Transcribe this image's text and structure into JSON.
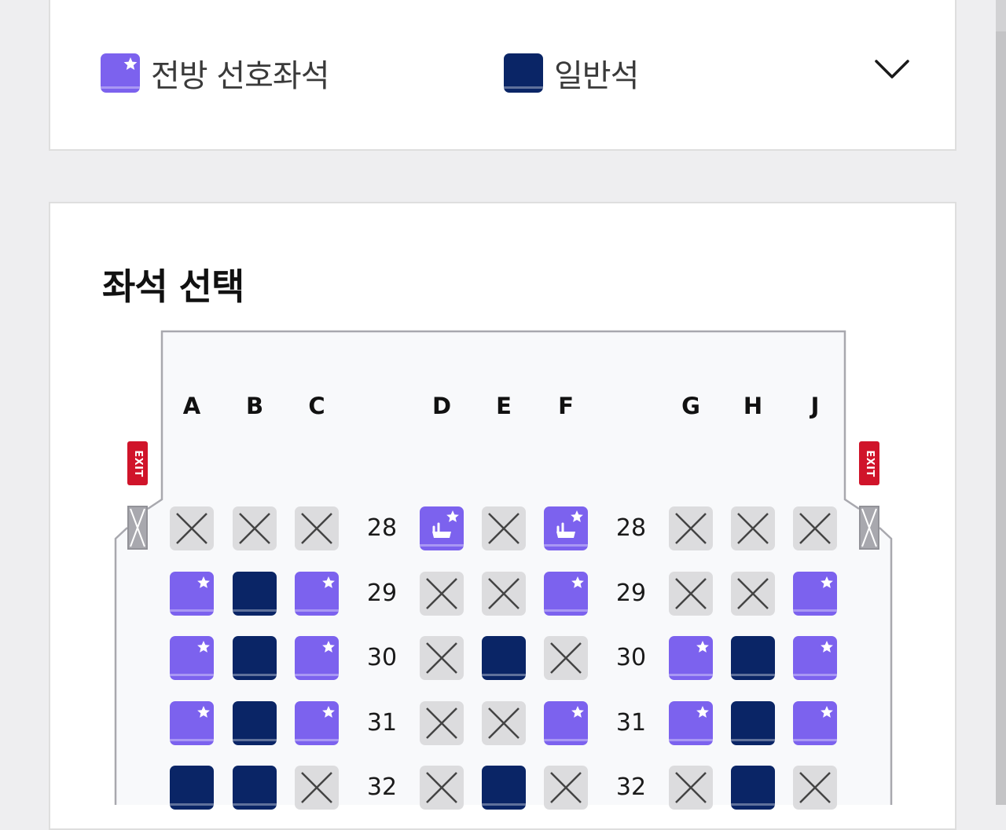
{
  "legend": {
    "preferred_label": "전방 선호좌석",
    "standard_label": "일반석",
    "preferred_color": "#7c62ee",
    "standard_color": "#0a2566",
    "expand_icon": "chevron-down-icon"
  },
  "seat_map": {
    "title": "좌석 선택",
    "exit_label": "EXIT",
    "columns": [
      "A",
      "B",
      "C",
      "D",
      "E",
      "F",
      "G",
      "H",
      "J"
    ],
    "occupied_color": "#dcdcde",
    "rows": [
      {
        "number": "28",
        "seats": [
          "occupied",
          "occupied",
          "occupied",
          "bassinet",
          "occupied",
          "bassinet",
          "occupied",
          "occupied",
          "occupied"
        ]
      },
      {
        "number": "29",
        "seats": [
          "preferred",
          "standard",
          "preferred",
          "occupied",
          "occupied",
          "preferred",
          "occupied",
          "occupied",
          "preferred"
        ]
      },
      {
        "number": "30",
        "seats": [
          "preferred",
          "standard",
          "preferred",
          "occupied",
          "standard",
          "occupied",
          "preferred",
          "standard",
          "preferred"
        ]
      },
      {
        "number": "31",
        "seats": [
          "preferred",
          "standard",
          "preferred",
          "occupied",
          "occupied",
          "preferred",
          "preferred",
          "standard",
          "preferred"
        ]
      },
      {
        "number": "32",
        "seats": [
          "standard",
          "standard",
          "occupied",
          "occupied",
          "standard",
          "occupied",
          "occupied",
          "standard",
          "occupied"
        ]
      }
    ]
  }
}
